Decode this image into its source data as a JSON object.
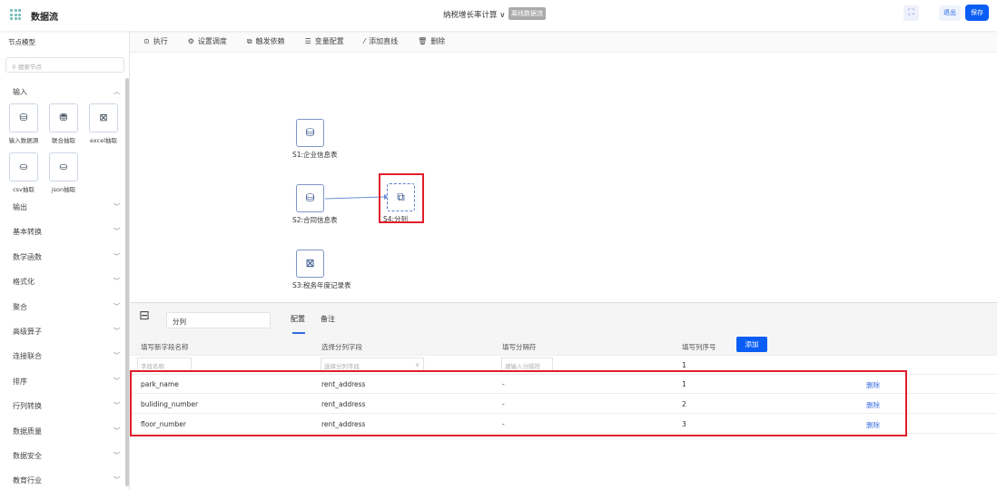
{
  "header": {
    "app_title": "数据流",
    "flow_name": "纳税增长率计算",
    "flow_chevron": "∨",
    "badge": "离线数据流",
    "exit_label": "退出",
    "save_label": "保存"
  },
  "sidebar": {
    "title": "节点模型",
    "search_placeholder": "搜索节点",
    "input_category": "输入",
    "input_items": [
      {
        "label": "输入数据源",
        "icon": "database-icon",
        "glyph": "⛁"
      },
      {
        "label": "联合抽取",
        "icon": "database-search-icon",
        "glyph": "⛃"
      },
      {
        "label": "excel抽取",
        "icon": "excel-icon",
        "glyph": "⊠"
      },
      {
        "label": "csv抽取",
        "icon": "csv-icon",
        "glyph": "⛀"
      },
      {
        "label": "json抽取",
        "icon": "json-icon",
        "glyph": "⛀"
      }
    ],
    "categories": [
      "输出",
      "基本转换",
      "数学函数",
      "格式化",
      "聚合",
      "高级算子",
      "连接联合",
      "排序",
      "行列转换",
      "数据质量",
      "数据安全",
      "教育行业"
    ]
  },
  "toolbar": [
    {
      "label": "执行",
      "glyph": "⊙"
    },
    {
      "label": "设置调度",
      "glyph": "⚙"
    },
    {
      "label": "触发依赖",
      "glyph": "⧉"
    },
    {
      "label": "变量配置",
      "glyph": "☰"
    },
    {
      "label": "添加直线",
      "glyph": "⁄"
    },
    {
      "label": "删除",
      "glyph": "🗑"
    }
  ],
  "canvas": {
    "nodes": [
      {
        "label": "S1:企业信息表",
        "glyph": "⛁"
      },
      {
        "label": "S2:合同信息表",
        "glyph": "⛁"
      },
      {
        "label": "S3:税务年度记录表",
        "glyph": "⊠"
      },
      {
        "label": "S4:分列",
        "glyph": "⧉"
      }
    ]
  },
  "panel": {
    "node_name": "分列",
    "tabs": [
      "配置",
      "备注"
    ],
    "columns": [
      "填写新字段名称",
      "选择分列字段",
      "填写分隔符",
      "填写列序号"
    ],
    "add_label": "添加",
    "input_row": {
      "field_placeholder": "字段名称",
      "select_placeholder": "选择分列字段",
      "sep_placeholder": "请输入分隔符",
      "index": "1"
    },
    "rows": [
      {
        "name": "park_name",
        "field": "rent_address",
        "sep": "-",
        "index": "1",
        "action": "删除"
      },
      {
        "name": "buliding_number",
        "field": "rent_address",
        "sep": "-",
        "index": "2",
        "action": "删除"
      },
      {
        "name": "floor_number",
        "field": "rent_address",
        "sep": "-",
        "index": "3",
        "action": "删除"
      }
    ]
  }
}
